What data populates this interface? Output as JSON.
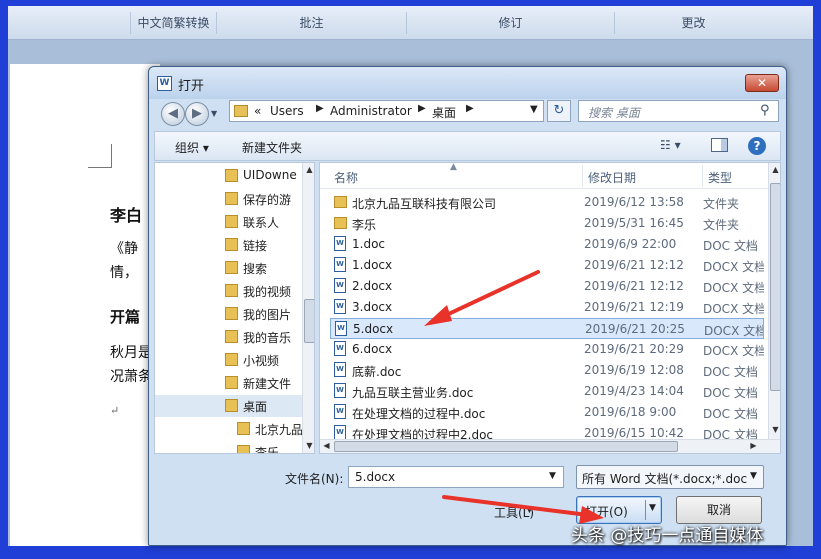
{
  "ribbon": {
    "groups": [
      "中文简繁转换",
      "批注",
      "修订",
      "更改"
    ]
  },
  "document": {
    "lines": [
      "李白",
      "《静",
      "情，",
      "开篇",
      "秋月是",
      "况萧条"
    ],
    "paragraph_mark": "↵"
  },
  "dialog": {
    "title": "打开",
    "close_label": "✕",
    "address": {
      "prefix": "«",
      "crumbs": [
        "Users",
        "Administrator",
        "桌面"
      ]
    },
    "search_placeholder": "搜索 桌面",
    "toolbar": {
      "organize_label": "组织 ▾",
      "new_folder_label": "新建文件夹",
      "view_label": "☷ ▾",
      "help_label": "?"
    },
    "nav_pane": {
      "items": [
        {
          "label": "UIDowne",
          "selected": false
        },
        {
          "label": "保存的游",
          "selected": false
        },
        {
          "label": "联系人",
          "selected": false
        },
        {
          "label": "链接",
          "selected": false
        },
        {
          "label": "搜索",
          "selected": false
        },
        {
          "label": "我的视频",
          "selected": false
        },
        {
          "label": "我的图片",
          "selected": false
        },
        {
          "label": "我的音乐",
          "selected": false
        },
        {
          "label": "小视频",
          "selected": false
        },
        {
          "label": "新建文件",
          "selected": false
        },
        {
          "label": "桌面",
          "selected": true
        },
        {
          "label": "北京九品",
          "selected": false
        },
        {
          "label": "李乐",
          "selected": false
        }
      ]
    },
    "file_list": {
      "columns": [
        "名称",
        "修改日期",
        "类型"
      ],
      "rows": [
        {
          "name": "北京九品互联科技有限公司",
          "date": "2019/6/12 13:58",
          "type": "文件夹",
          "kind": "folder",
          "selected": false
        },
        {
          "name": "李乐",
          "date": "2019/5/31 16:45",
          "type": "文件夹",
          "kind": "folder",
          "selected": false
        },
        {
          "name": "1.doc",
          "date": "2019/6/9 22:00",
          "type": "DOC 文档",
          "kind": "doc",
          "selected": false
        },
        {
          "name": "1.docx",
          "date": "2019/6/21 12:12",
          "type": "DOCX 文档",
          "kind": "doc",
          "selected": false
        },
        {
          "name": "2.docx",
          "date": "2019/6/21 12:12",
          "type": "DOCX 文档",
          "kind": "doc",
          "selected": false
        },
        {
          "name": "3.docx",
          "date": "2019/6/21 12:19",
          "type": "DOCX 文档",
          "kind": "doc",
          "selected": false
        },
        {
          "name": "5.docx",
          "date": "2019/6/21 20:25",
          "type": "DOCX 文档",
          "kind": "doc",
          "selected": true
        },
        {
          "name": "6.docx",
          "date": "2019/6/21 20:29",
          "type": "DOCX 文档",
          "kind": "doc",
          "selected": false
        },
        {
          "name": "底薪.doc",
          "date": "2019/6/19 12:08",
          "type": "DOC 文档",
          "kind": "doc",
          "selected": false
        },
        {
          "name": "九品互联主营业务.doc",
          "date": "2019/4/23 14:04",
          "type": "DOC 文档",
          "kind": "doc",
          "selected": false
        },
        {
          "name": "在处理文档的过程中.doc",
          "date": "2019/6/18 9:00",
          "type": "DOC 文档",
          "kind": "doc",
          "selected": false
        },
        {
          "name": "在处理文档的过程中2.doc",
          "date": "2019/6/15 10:42",
          "type": "DOC 文档",
          "kind": "doc",
          "selected": false
        }
      ]
    },
    "filename_label": "文件名(N):",
    "filename_value": "5.docx",
    "filetype_value": "所有 Word 文档(*.docx;*.docm;*.dotx;*.dotm;*.doc;*.dot)",
    "tools_label": "工具(L)",
    "open_label": "打开(O)",
    "cancel_label": "取消"
  },
  "annotation_color": "#e8322a",
  "watermark": "头条 @技巧一点通自媒体"
}
